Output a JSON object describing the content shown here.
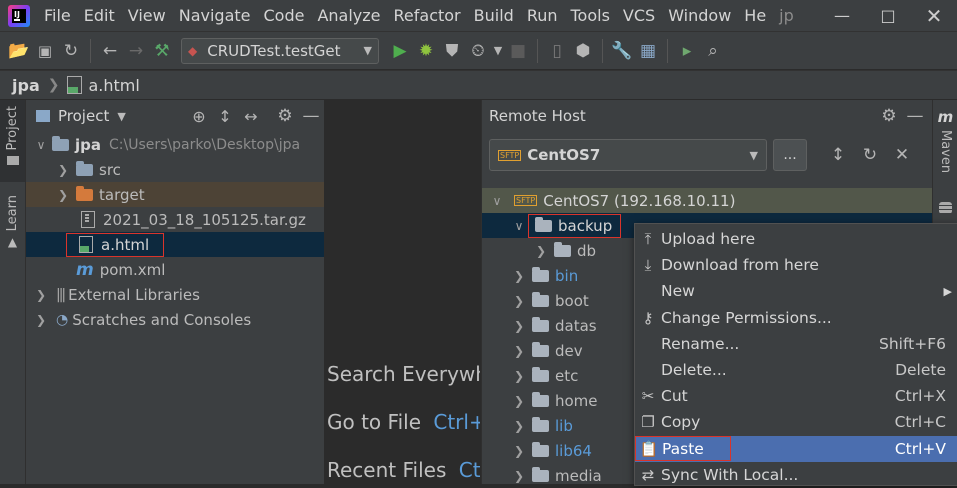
{
  "menubar": {
    "items": [
      "File",
      "Edit",
      "View",
      "Navigate",
      "Code",
      "Analyze",
      "Refactor",
      "Build",
      "Run",
      "Tools",
      "VCS",
      "Window",
      "He"
    ],
    "project_name": "jp"
  },
  "toolbar": {
    "run_config": "CRUDTest.testGet",
    "colors": {
      "run": "#4fae4e",
      "debug": "#8fc43f",
      "accent": "#4b6eaf"
    }
  },
  "breadcrumb": {
    "project": "jpa",
    "file": "a.html"
  },
  "left_strip": {
    "project_tab": "Project",
    "learn_tab": "Learn"
  },
  "right_strip": {
    "maven_tab": "Maven"
  },
  "project_panel": {
    "title": "Project",
    "root_name": "jpa",
    "root_path": "C:\\Users\\parko\\Desktop\\jpa",
    "children": [
      {
        "name": "src"
      },
      {
        "name": "target"
      },
      {
        "name": "2021_03_18_105125.tar.gz"
      },
      {
        "name": "a.html"
      },
      {
        "name": "pom.xml"
      }
    ],
    "external_libraries": "External Libraries",
    "scratches": "Scratches and Consoles"
  },
  "editor_hints": {
    "search": "Search Everywhere",
    "goto_file": "Go to File",
    "goto_file_key": "Ctrl+Shift+N",
    "recent": "Recent Files",
    "recent_key": "Ctrl+E"
  },
  "remote_host": {
    "title": "Remote Host",
    "server_select": "CentOS7",
    "browse_label": "...",
    "sftp_badge": "SFTP",
    "root_label": "CentOS7 (192.168.10.11)",
    "folders": [
      {
        "name": "backup"
      },
      {
        "name": "db"
      },
      {
        "name": "bin"
      },
      {
        "name": "boot"
      },
      {
        "name": "datas"
      },
      {
        "name": "dev"
      },
      {
        "name": "etc"
      },
      {
        "name": "home"
      },
      {
        "name": "lib"
      },
      {
        "name": "lib64"
      },
      {
        "name": "media"
      }
    ]
  },
  "context_menu": {
    "items": [
      {
        "label": "Upload here",
        "shortcut": ""
      },
      {
        "label": "Download from here",
        "shortcut": ""
      },
      {
        "label": "New",
        "shortcut": ""
      },
      {
        "label": "Change Permissions...",
        "shortcut": ""
      },
      {
        "label": "Rename...",
        "shortcut": "Shift+F6"
      },
      {
        "label": "Delete...",
        "shortcut": "Delete"
      },
      {
        "label": "Cut",
        "shortcut": "Ctrl+X"
      },
      {
        "label": "Copy",
        "shortcut": "Ctrl+C"
      },
      {
        "label": "Paste",
        "shortcut": "Ctrl+V"
      },
      {
        "label": "Sync With Local...",
        "shortcut": ""
      }
    ],
    "highlight_color": "#4b6eaf"
  }
}
